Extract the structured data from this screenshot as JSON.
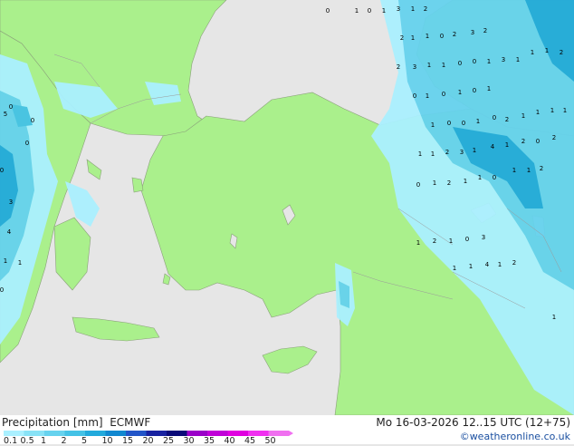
{
  "footer": {
    "product": "Precipitation [mm]",
    "model": "ECMWF",
    "valid_time": "Mo 16-03-2026 12..15 UTC (12+75)",
    "credit": "©weatheronline.co.uk"
  },
  "legend": {
    "labels": [
      "0.1",
      "0.5",
      "1",
      "2",
      "5",
      "10",
      "15",
      "20",
      "25",
      "30",
      "35",
      "40",
      "45",
      "50"
    ],
    "colors": [
      "#aaf0ff",
      "#88e2f6",
      "#66d2ee",
      "#44c2e6",
      "#22aadc",
      "#1188d0",
      "#2255c8",
      "#1822a0",
      "#0a0a78",
      "#9a00c8",
      "#c000d8",
      "#e000e0",
      "#f030f0",
      "#f070f0"
    ]
  },
  "map_colors": {
    "sea": "#e6e6e6",
    "land": "#aaf08c",
    "precip_light": "#aaf0ff",
    "precip_mid": "#66d2ee",
    "precip_heavy": "#22aadc"
  },
  "map": {
    "gridpoint_values": [
      "0",
      "1",
      "0",
      "1",
      "3",
      "1",
      "2",
      "2",
      "1",
      "1",
      "0",
      "2",
      "3",
      "2",
      "2",
      "3",
      "1",
      "1",
      "0",
      "0",
      "1",
      "3",
      "1",
      "1",
      "1",
      "2",
      "0",
      "1",
      "0",
      "1",
      "0",
      "1",
      "1",
      "0",
      "0",
      "1",
      "0",
      "2",
      "1",
      "1",
      "1",
      "1",
      "3",
      "1",
      "4",
      "1",
      "2",
      "0",
      "2",
      "1",
      "1",
      "2",
      "0",
      "1",
      "2",
      "1",
      "1",
      "0",
      "1",
      "1",
      "2",
      "1",
      "2",
      "1",
      "0",
      "3",
      "1",
      "1",
      "4",
      "1",
      "2",
      "1",
      "0",
      "0",
      "5",
      "0",
      "3",
      "0",
      "4",
      "1",
      "1",
      "0"
    ]
  }
}
